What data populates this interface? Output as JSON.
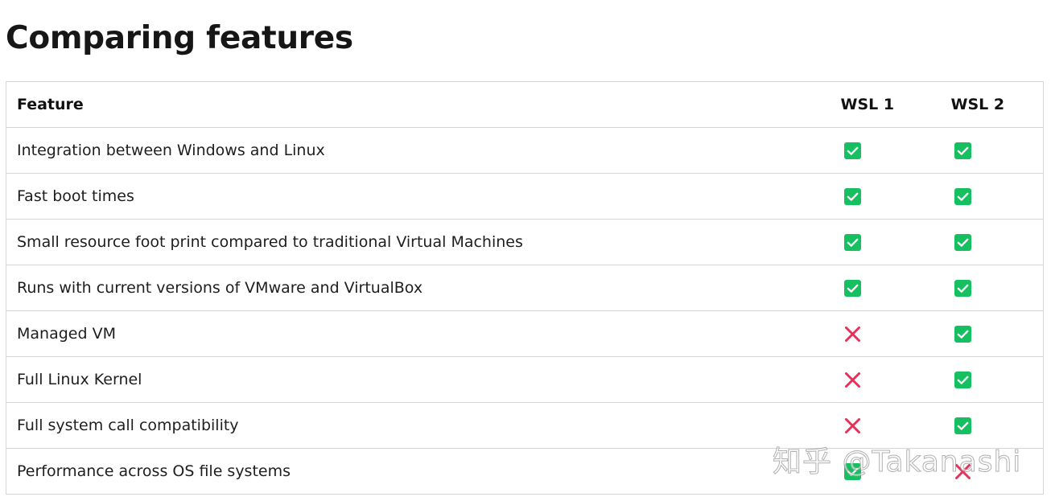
{
  "page": {
    "title": "Comparing features"
  },
  "table": {
    "headers": [
      "Feature",
      "WSL 1",
      "WSL 2"
    ],
    "rows": [
      {
        "feature": "Integration between Windows and Linux",
        "wsl1": "yes",
        "wsl2": "yes"
      },
      {
        "feature": "Fast boot times",
        "wsl1": "yes",
        "wsl2": "yes"
      },
      {
        "feature": "Small resource foot print compared to traditional Virtual Machines",
        "wsl1": "yes",
        "wsl2": "yes"
      },
      {
        "feature": "Runs with current versions of VMware and VirtualBox",
        "wsl1": "yes",
        "wsl2": "yes"
      },
      {
        "feature": "Managed VM",
        "wsl1": "no",
        "wsl2": "yes"
      },
      {
        "feature": "Full Linux Kernel",
        "wsl1": "no",
        "wsl2": "yes"
      },
      {
        "feature": "Full system call compatibility",
        "wsl1": "no",
        "wsl2": "yes"
      },
      {
        "feature": "Performance across OS file systems",
        "wsl1": "yes",
        "wsl2": "no"
      }
    ]
  },
  "icons": {
    "yes": "check-icon",
    "no": "cross-icon"
  },
  "colors": {
    "check": "#16c060",
    "cross": "#e5305a"
  },
  "watermark": "知乎 @Takanashi"
}
